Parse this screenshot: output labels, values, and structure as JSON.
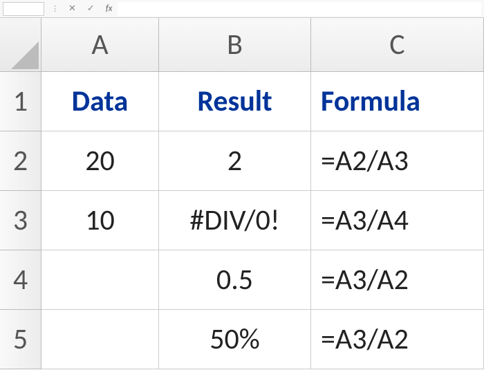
{
  "formula_bar": {
    "name_box": "",
    "cancel": "✕",
    "enter": "✓",
    "fx": "fx",
    "formula_input": ""
  },
  "columns": [
    "A",
    "B",
    "C"
  ],
  "rows": [
    "1",
    "2",
    "3",
    "4",
    "5"
  ],
  "headers": {
    "a": "Data",
    "b": "Result",
    "c": "Formula"
  },
  "r2": {
    "a": "20",
    "b": "2",
    "c": "=A2/A3"
  },
  "r3": {
    "a": "10",
    "b": "#DIV/0!",
    "c": "=A3/A4"
  },
  "r4": {
    "a": "",
    "b": "0.5",
    "c": "=A3/A2"
  },
  "r5": {
    "a": "",
    "b": "50%",
    "c": "=A3/A2"
  }
}
